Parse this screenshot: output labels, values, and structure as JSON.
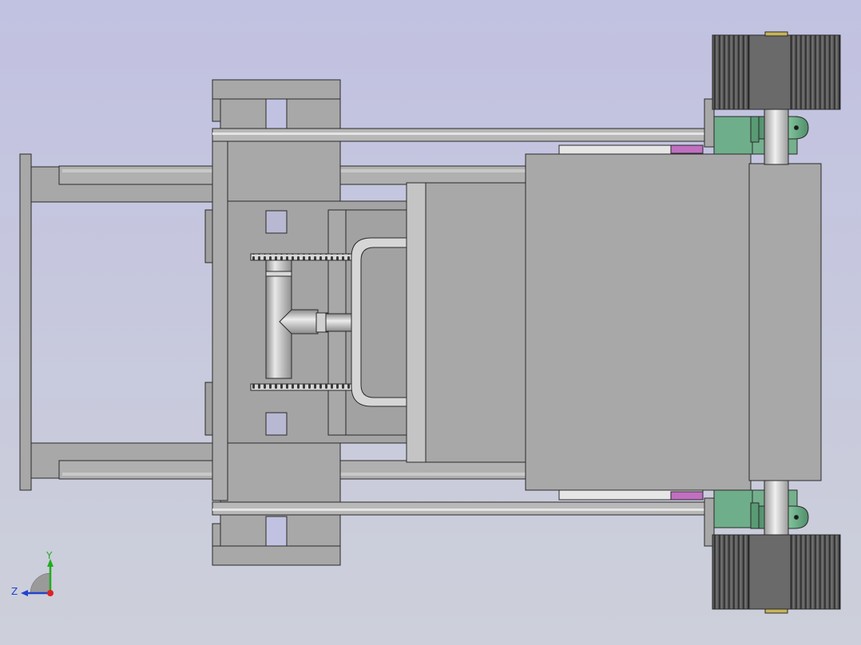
{
  "viewport": {
    "background_top": "#c1c1e1",
    "background_bottom": "#cdd0da",
    "part_gray": "#a8a8a8",
    "part_gray_light": "#b4b4b4",
    "tire_dark": "#5a5a5a",
    "bracket_green": "#6fae8a",
    "pin_gold": "#c8b45a",
    "accent_magenta": "#c040c0",
    "edge_color": "#2a2a2a"
  },
  "triad": {
    "y_label": "Y",
    "z_label": "Z",
    "y_color": "#22aa22",
    "z_color": "#2244cc",
    "x_color": "#dd2222"
  }
}
